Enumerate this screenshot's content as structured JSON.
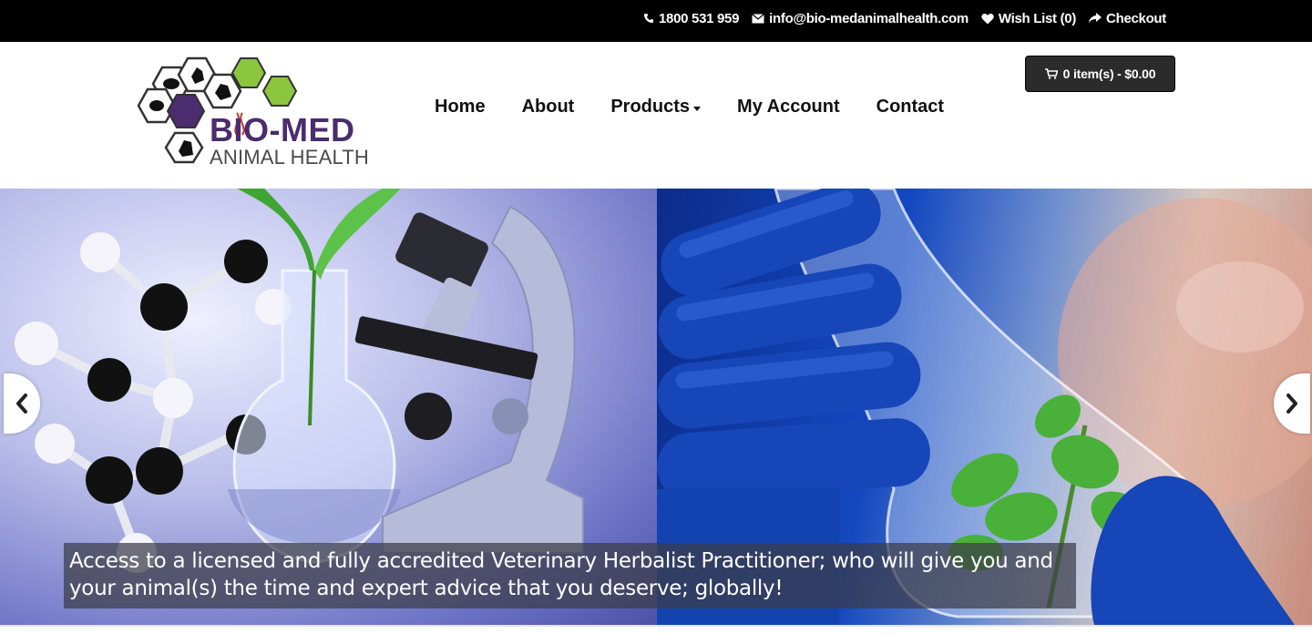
{
  "topbar": {
    "phone": "1800 531 959",
    "email": "info@bio-medanimalhealth.com",
    "wishlist": "Wish List (0)",
    "checkout": "Checkout"
  },
  "logo": {
    "brand": "BIO-MED",
    "tagline": "ANIMAL HEALTH",
    "purple": "#4b2c6e",
    "green": "#8cc63f"
  },
  "nav": {
    "items": [
      {
        "label": "Home"
      },
      {
        "label": "About"
      },
      {
        "label": "Products"
      },
      {
        "label": "My Account"
      },
      {
        "label": "Contact"
      }
    ]
  },
  "cart": {
    "label": "0 item(s) - $0.00"
  },
  "slider": {
    "caption": "Access to a licensed and fully accredited Veterinary Herbalist Practitioner; who will give you and your animal(s) the time and expert advice that you deserve; globally!",
    "prev_icon": "chevron-left-icon",
    "next_icon": "chevron-right-icon"
  }
}
